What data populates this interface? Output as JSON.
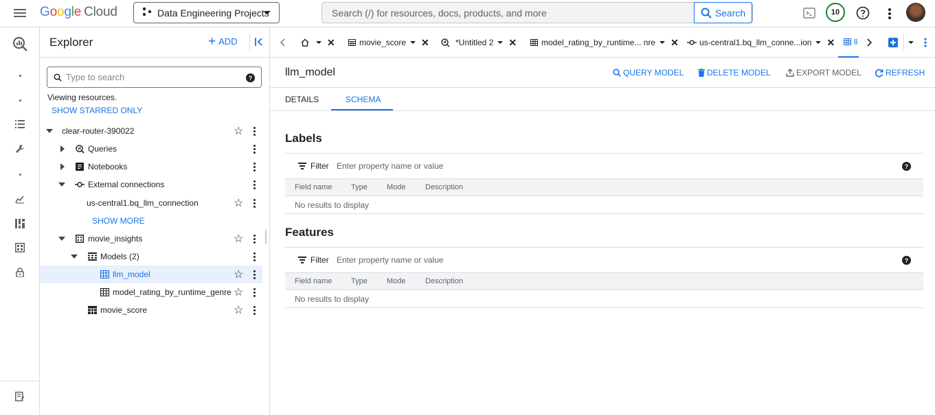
{
  "topbar": {
    "logo_parts": [
      "G",
      "o",
      "o",
      "g",
      "l",
      "e"
    ],
    "logo_cloud": "Cloud",
    "project": "Data Engineering Projects",
    "search_placeholder": "Search (/) for resources, docs, products, and more",
    "search_button": "Search",
    "notifications_count": "10"
  },
  "explorer": {
    "title": "Explorer",
    "add_label": "ADD",
    "search_placeholder": "Type to search",
    "viewing_text": "Viewing resources.",
    "show_starred": "SHOW STARRED ONLY",
    "show_more": "SHOW MORE",
    "tree": [
      {
        "label": "clear-router-390022",
        "icon": "none"
      },
      {
        "label": "Queries",
        "icon": "query-icon"
      },
      {
        "label": "Notebooks",
        "icon": "notebook-icon"
      },
      {
        "label": "External connections",
        "icon": "connection-icon"
      },
      {
        "label": "us-central1.bq_llm_connection",
        "icon": "none"
      },
      {
        "label": "movie_insights",
        "icon": "dataset-icon"
      },
      {
        "label": "Models (2)",
        "icon": "models-icon"
      },
      {
        "label": "llm_model",
        "icon": "model-icon"
      },
      {
        "label": "model_rating_by_runtime_genre",
        "icon": "model-icon"
      },
      {
        "label": "movie_score",
        "icon": "table-icon"
      }
    ]
  },
  "tabs": [
    {
      "label": "",
      "icon": "home-icon"
    },
    {
      "label": "movie_score",
      "icon": "table-icon"
    },
    {
      "label": "*Untitled 2",
      "icon": "query-icon"
    },
    {
      "label": "model_rating_by_runtime... nre",
      "icon": "model-icon"
    },
    {
      "label": "us-central1.bq_llm_conne...ion",
      "icon": "connection-icon"
    },
    {
      "label": "ll",
      "icon": "model-icon"
    }
  ],
  "main": {
    "title": "llm_model",
    "actions": {
      "query": "QUERY MODEL",
      "delete": "DELETE MODEL",
      "export": "EXPORT MODEL",
      "refresh": "REFRESH"
    },
    "subtabs": [
      "DETAILS",
      "SCHEMA"
    ],
    "filter_label": "Filter",
    "filter_placeholder": "Enter property name or value",
    "columns": [
      "Field name",
      "Type",
      "Mode",
      "Description"
    ],
    "sections": [
      {
        "title": "Labels",
        "empty_text": "No results to display"
      },
      {
        "title": "Features",
        "empty_text": "No results to display"
      }
    ]
  },
  "colors": {
    "accent": "#1a73e8",
    "border": "#dadce0",
    "selected_bg": "#e8f0fe"
  }
}
